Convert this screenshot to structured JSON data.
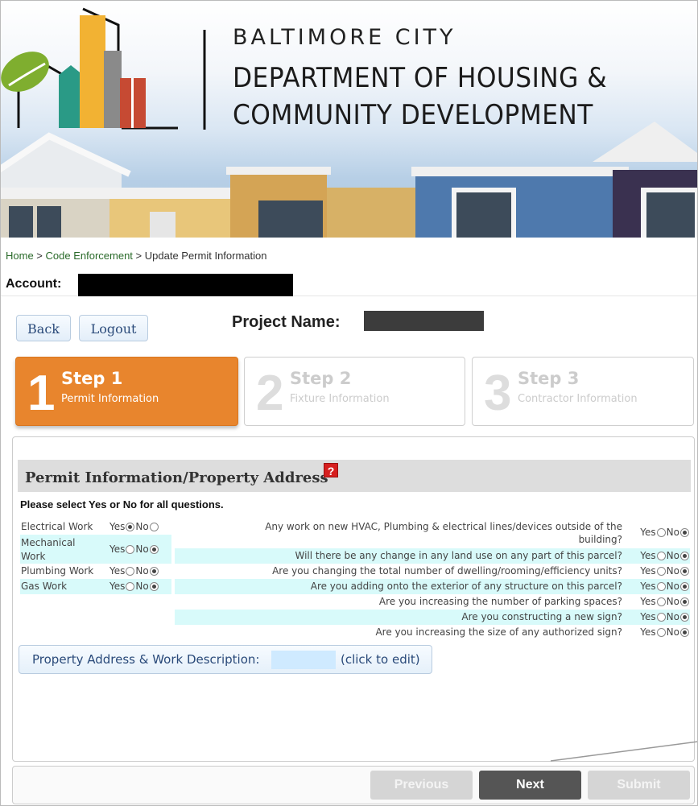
{
  "header": {
    "org_line1": "BALTIMORE CITY",
    "org_line2": "DEPARTMENT OF HOUSING &",
    "org_line3": "COMMUNITY DEVELOPMENT"
  },
  "breadcrumb": {
    "home": "Home",
    "sep1": " > ",
    "code_enforcement": "Code Enforcement",
    "sep2": " > ",
    "current": "Update Permit Information"
  },
  "account": {
    "label": "Account:"
  },
  "toolbar": {
    "back": "Back",
    "logout": "Logout"
  },
  "project": {
    "label": "Project Name:"
  },
  "steps": [
    {
      "number": "1",
      "title": "Step 1",
      "subtitle": "Permit Information"
    },
    {
      "number": "2",
      "title": "Step 2",
      "subtitle": "Fixture Information"
    },
    {
      "number": "3",
      "title": "Step 3",
      "subtitle": "Contractor Information"
    }
  ],
  "section": {
    "title": "Permit Information/Property Address",
    "help_icon": "?",
    "instructions": "Please select Yes or No for all questions."
  },
  "yes_label": "Yes",
  "no_label": "No",
  "work_types": [
    {
      "label": "Electrical Work",
      "selected": "Yes"
    },
    {
      "label": "Mechanical Work",
      "selected": "No"
    },
    {
      "label": "Plumbing Work",
      "selected": "No"
    },
    {
      "label": "Gas Work",
      "selected": "No"
    }
  ],
  "questions": [
    {
      "text": "Any work on new HVAC, Plumbing & electrical lines/devices outside of the",
      "text2": "building?",
      "selected": "No"
    },
    {
      "text": "Will there be any change in any land use on any part of this parcel?",
      "selected": "No"
    },
    {
      "text": "Are you changing the total number of dwelling/rooming/efficiency units?",
      "selected": "No"
    },
    {
      "text": "Are you adding onto the exterior of any structure on this parcel?",
      "selected": "No"
    },
    {
      "text": "Are you increasing the number of parking spaces?",
      "selected": "No"
    },
    {
      "text": "Are you constructing a new sign?",
      "selected": "No"
    },
    {
      "text": "Are you increasing the size of any authorized sign?",
      "selected": "No"
    }
  ],
  "address": {
    "label": "Property Address & Work Description:",
    "edit_hint": "(click to edit)"
  },
  "footer": {
    "previous": "Previous",
    "next": "Next",
    "submit": "Submit"
  },
  "colors": {
    "step_active": "#e8852d",
    "row_highlight": "#d8fafa",
    "next_button": "#555555",
    "disabled_button": "#d5d5d5",
    "help_icon": "#d61f1f"
  }
}
